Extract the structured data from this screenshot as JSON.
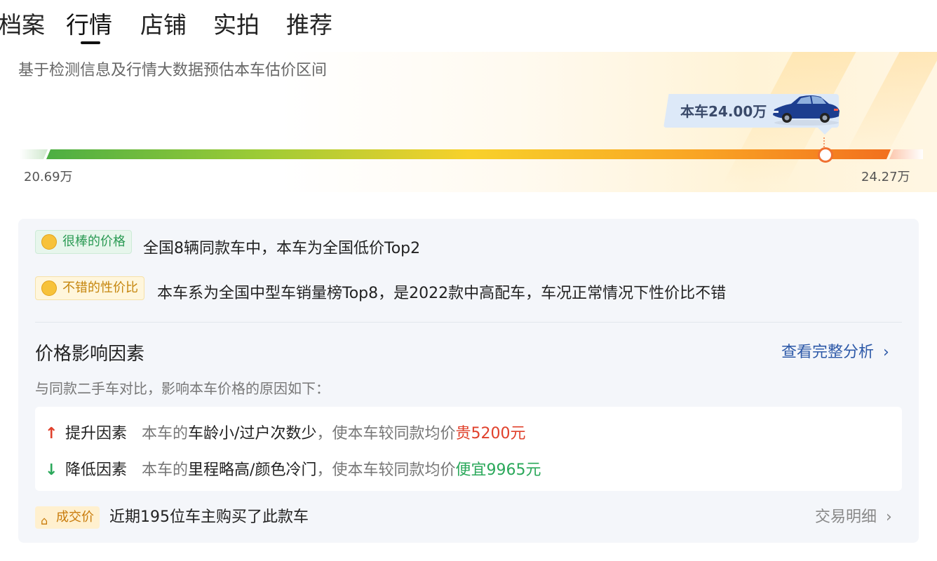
{
  "tabs": [
    {
      "label": "档案",
      "active": false
    },
    {
      "label": "行情",
      "active": true
    },
    {
      "label": "店铺",
      "active": false
    },
    {
      "label": "实拍",
      "active": false
    },
    {
      "label": "推荐",
      "active": false
    }
  ],
  "hero": {
    "subtitle": "基于检测信息及行情大数据预估本车估价区间",
    "price_tag": "本车24.00万",
    "range_min": "20.69万",
    "range_max": "24.27万",
    "current_value": 24.0,
    "min_value": 20.69,
    "max_value": 24.27
  },
  "highlights": [
    {
      "badge": "很棒的价格",
      "icon": "grinning-face-icon",
      "text": "全国8辆同款车中，本车为全国低价Top2"
    },
    {
      "badge": "不错的性价比",
      "icon": "smiling-face-icon",
      "text": "本车系为全国中型车销量榜Top8，是2022款中高配车，车况正常情况下性价比不错"
    }
  ],
  "factors": {
    "title": "价格影响因素",
    "link": "查看完整分析",
    "subtitle": "与同款二手车对比，影响本车价格的原因如下：",
    "rows": [
      {
        "arrow": "↑",
        "label": "提升因素",
        "desc_prefix": "本车的",
        "desc_main": "车龄小/过户次数少",
        "desc_mid": "，使本车较同款均价",
        "highlight": "贵5200元"
      },
      {
        "arrow": "↓",
        "label": "降低因素",
        "desc_prefix": "本车的",
        "desc_main": "里程略高/颜色冷门",
        "desc_mid": "，使本车较同款均价",
        "highlight": "便宜9965元"
      }
    ]
  },
  "deal": {
    "badge": "成交价",
    "text": "近期195位车主购买了此款车",
    "link": "交易明细"
  },
  "colors": {
    "accent_blue": "#2d59a8",
    "up_red": "#e0402b",
    "down_green": "#2aa85a",
    "bar_green": "#4cae43",
    "bar_yellow": "#f8d12a",
    "bar_orange": "#f2701e"
  }
}
